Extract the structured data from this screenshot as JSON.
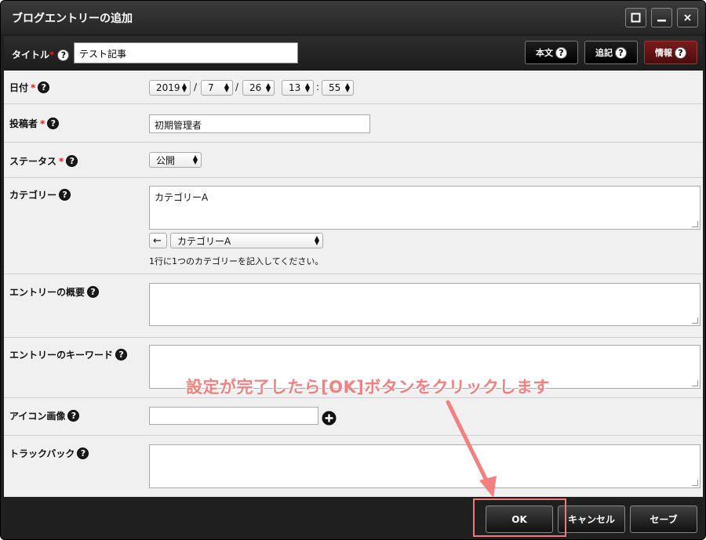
{
  "window": {
    "title": "ブログエントリーの追加"
  },
  "header": {
    "title_label": "タイトル",
    "required_mark": "*",
    "help_glyph": "?",
    "title_value": "テスト記事",
    "tabs": [
      {
        "label": "本文",
        "active": false
      },
      {
        "label": "追記",
        "active": false
      },
      {
        "label": "情報",
        "active": true
      }
    ]
  },
  "fields": {
    "date": {
      "label": "日付",
      "year": "2019",
      "month": "7",
      "day": "26",
      "hour": "13",
      "minute": "55",
      "sep_slash": "/",
      "sep_colon": ":"
    },
    "author": {
      "label": "投稿者",
      "value": "初期管理者"
    },
    "status": {
      "label": "ステータス",
      "value": "公開"
    },
    "category": {
      "label": "カテゴリー",
      "value": "カテゴリーA",
      "back_arrow": "←",
      "select_value": "カテゴリーA",
      "hint": "1行に1つのカテゴリーを記入してください。"
    },
    "summary": {
      "label": "エントリーの概要",
      "value": ""
    },
    "keywords": {
      "label": "エントリーのキーワード",
      "value": ""
    },
    "icon": {
      "label": "アイコン画像",
      "value": ""
    },
    "trackback": {
      "label": "トラックバック",
      "value": ""
    }
  },
  "footer": {
    "ok_label": "OK",
    "cancel_label": "キャンセル",
    "save_label": "セーブ"
  },
  "annotation": {
    "text": "設定が完了したら[OK]ボタンをクリックします",
    "color": "#f47f7f"
  },
  "colors": {
    "active_tab": "#6b1515",
    "required": "#e02020"
  }
}
